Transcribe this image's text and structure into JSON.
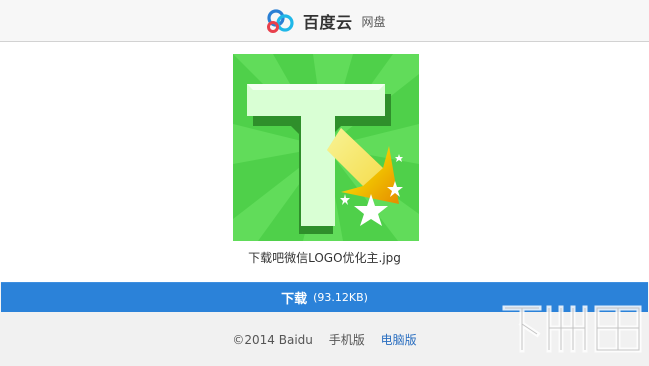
{
  "header": {
    "brand": "百度云",
    "product": "网盘"
  },
  "file": {
    "name": "下载吧微信LOGO优化主.jpg"
  },
  "download": {
    "label": "下载",
    "size": "(93.12KB)"
  },
  "footer": {
    "copyright": "©2014 Baidu",
    "mobile_link": "手机版",
    "desktop_link": "电脑版"
  },
  "colors": {
    "accent": "#2b82d9",
    "link": "#2b6fc0",
    "thumb_green": "#4fd04a"
  }
}
